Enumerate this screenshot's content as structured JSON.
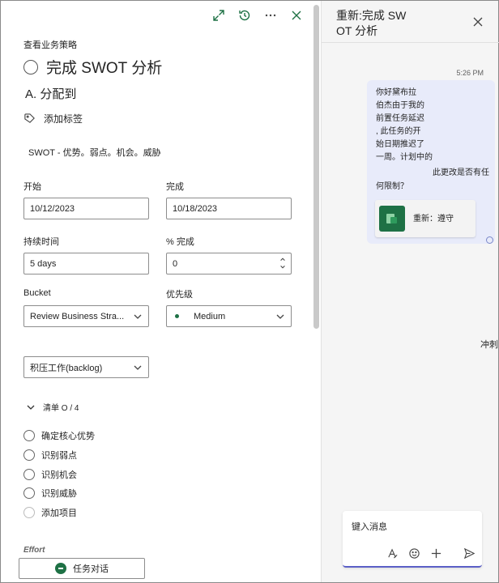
{
  "task": {
    "breadcrumb": "查看业务策略",
    "title": "完成 SWOT 分析",
    "assign": "A. 分配到",
    "add_label": "添加标签",
    "notes": "SWOT - 优势。弱点。机会。威胁",
    "start": {
      "label": "开始",
      "value": "10/12/2023"
    },
    "finish": {
      "label": "完成",
      "value": "10/18/2023"
    },
    "duration": {
      "label": "持续时间",
      "value": "5 days"
    },
    "percent": {
      "label": "% 完成",
      "value": "0"
    },
    "bucket": {
      "label": "Bucket",
      "value": "Review Business Stra..."
    },
    "priority": {
      "label": "优先级",
      "value": "Medium"
    },
    "progress": {
      "value": "积压工作(backlog)"
    },
    "checklist": {
      "header": "清单 O / 4",
      "items": [
        "确定核心优势",
        "识别弱点",
        "识别机会",
        "识别威胁"
      ],
      "add_item": "添加项目"
    },
    "cut_off_label": "Effort",
    "chat_button": "任务对话"
  },
  "chat": {
    "title": "重新:完成 SWOT 分析",
    "title_lines": [
      "重新:完成 SW",
      "OT 分析"
    ],
    "time": "5:26 PM",
    "message_lines": [
      "你好黛布拉",
      "伯杰由于我的",
      "前置任务延迟",
      ", 此任务的开",
      "始日期推迟了",
      "一周。计划中的",
      "此更改是否有任",
      "何限制？"
    ],
    "card_label": "重新：遵守",
    "overflow_word": "冲刺",
    "compose_placeholder": "键入消息"
  },
  "colors": {
    "accent": "#1e7145",
    "bubble": "#e8ebfa",
    "compose_underline": "#5b5fc7"
  }
}
